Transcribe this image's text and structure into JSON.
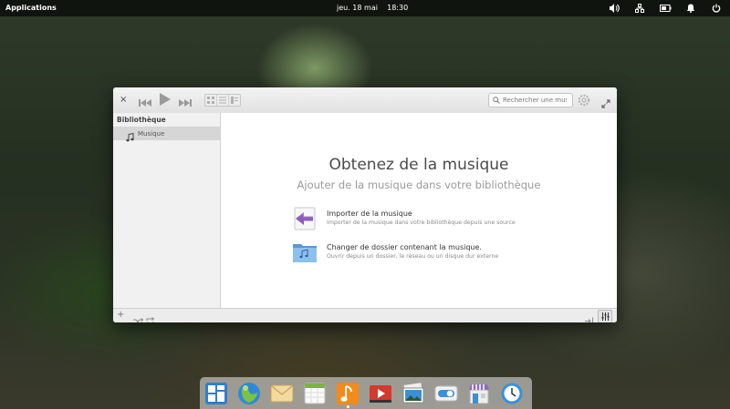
{
  "top_panel": {
    "applications_label": "Applications",
    "date": "jeu. 18 mai",
    "time": "18:30",
    "indicators": [
      "volume-icon",
      "network-icon",
      "battery-icon",
      "notifications-icon",
      "power-icon"
    ]
  },
  "window": {
    "close_label": "×",
    "search": {
      "placeholder": "Rechercher une musi..."
    },
    "sidebar": {
      "heading": "Bibliothèque",
      "items": [
        {
          "label": "Musique",
          "icon": "music-note-icon",
          "selected": true
        }
      ]
    },
    "welcome": {
      "title": "Obtenez de la musique",
      "subtitle": "Ajouter de la musique dans votre bibliothèque",
      "actions": [
        {
          "title": "Importer de la musique",
          "description": "Importer de la musique dans votre bibliothèque depuis une source",
          "icon": "import-icon"
        },
        {
          "title": "Changer de dossier contenant la musique.",
          "description": "Ouvrir depuis un dossier, le réseau ou un disque dur externe",
          "icon": "music-folder-icon"
        }
      ]
    },
    "bottombar": {
      "add_label": "+"
    }
  },
  "dock": {
    "apps": [
      "multitasking-view",
      "web-browser",
      "mail",
      "calendar",
      "music",
      "videos",
      "photos",
      "system-settings",
      "appcenter",
      "clock"
    ],
    "accent_colors": {
      "music": "#f28b1a",
      "videos": "#d33a2c",
      "browser": "#2e8ad8"
    }
  }
}
